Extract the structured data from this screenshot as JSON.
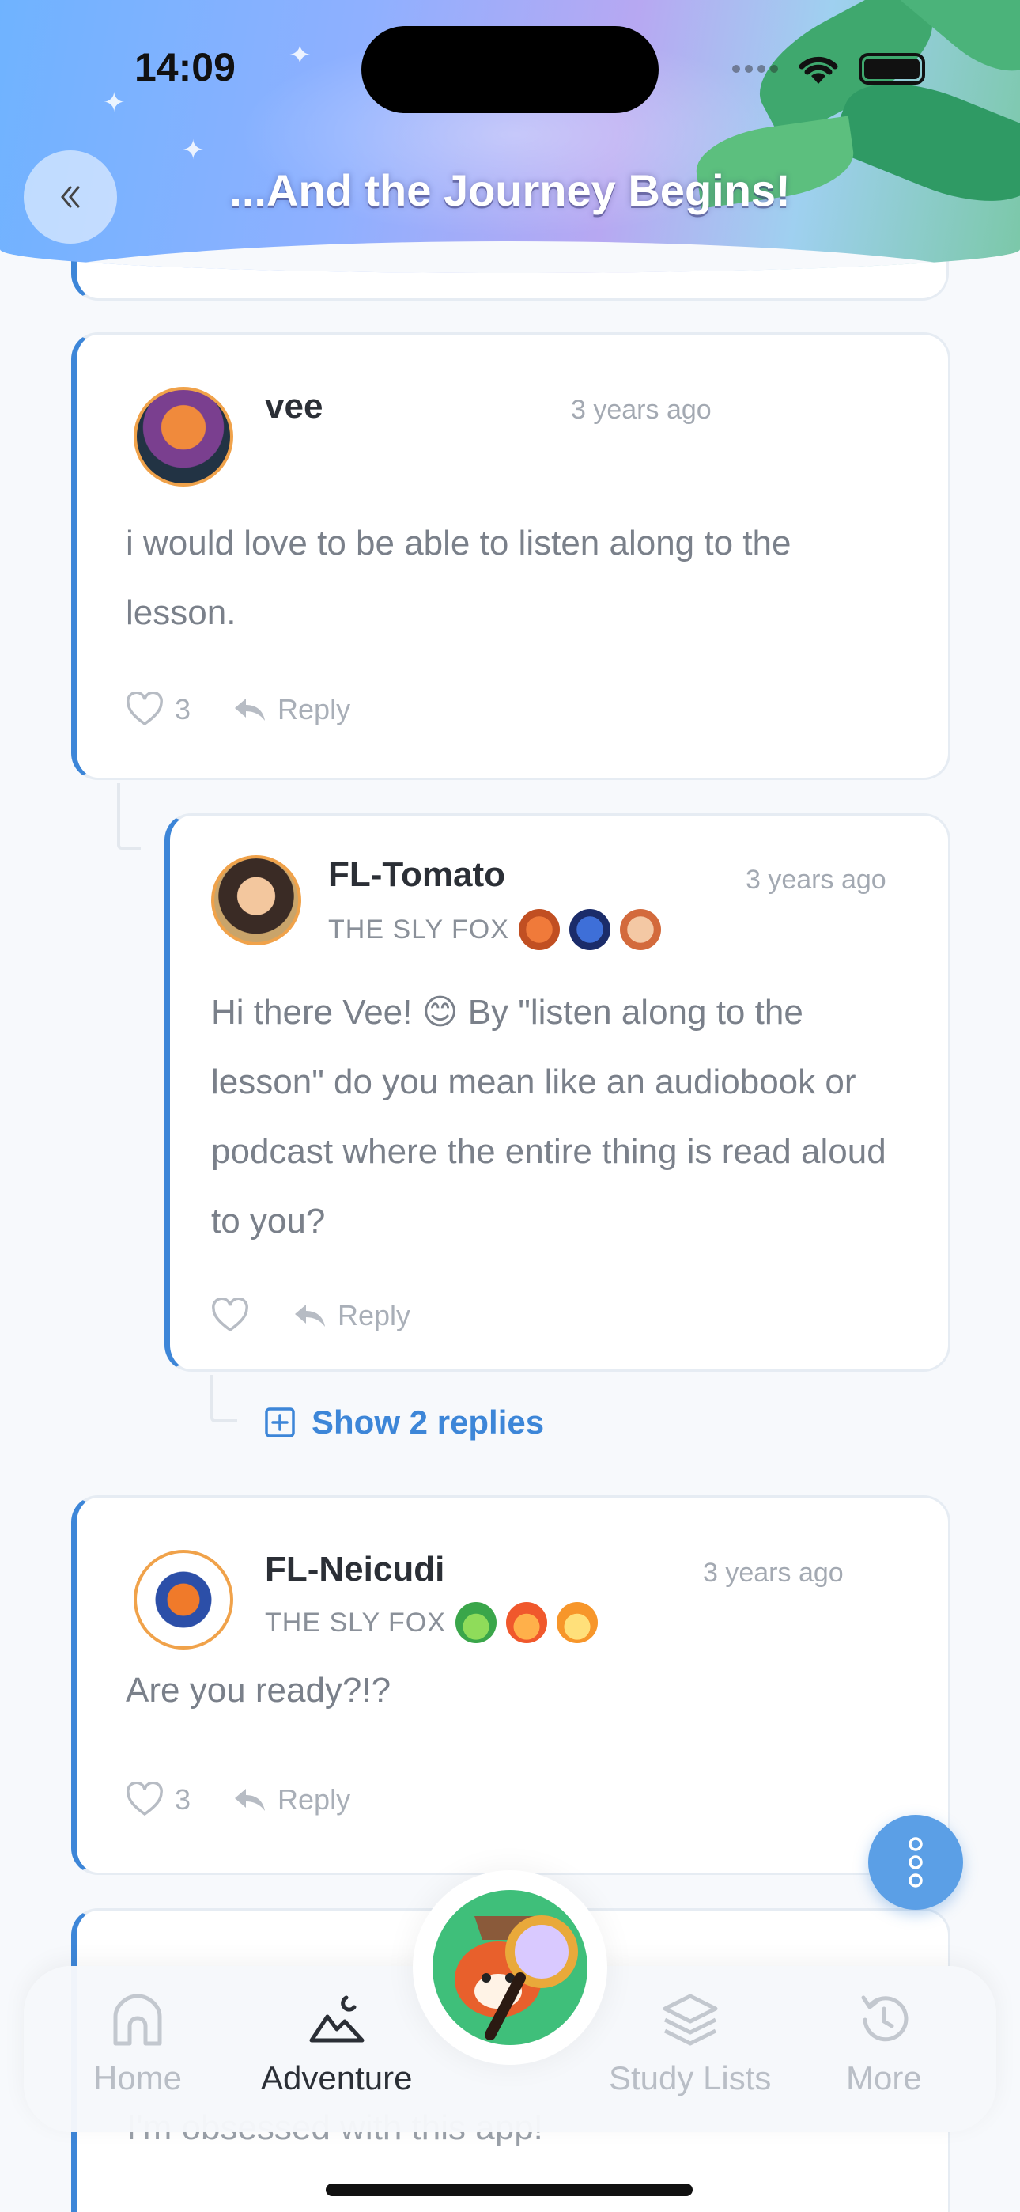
{
  "status_bar": {
    "time": "14:09"
  },
  "header": {
    "title": "...And the Journey Begins!"
  },
  "comments": [
    {
      "username": "vee",
      "timestamp": "3 years ago",
      "text": "i would love to be able to listen along to the lesson.",
      "likes": "3",
      "reply_label": "Reply"
    },
    {
      "username": "FL-Tomato",
      "timestamp": "3 years ago",
      "rank": "THE SLY FOX",
      "text": "Hi there Vee! 😊  By \"listen along to the lesson\" do you mean like an audiobook or podcast where the entire thing is read aloud to you?",
      "likes": "",
      "reply_label": "Reply"
    },
    {
      "username": "FL-Neicudi",
      "timestamp": "3 years ago",
      "rank": "THE SLY FOX",
      "text": "Are you ready?!?",
      "likes": "3",
      "reply_label": "Reply"
    }
  ],
  "show_replies": "Show 2 replies",
  "peek_comment_text": "I'm obsessed with this app!",
  "tabbar": {
    "tabs": [
      {
        "label": "Home",
        "icon": "home-icon",
        "active": false
      },
      {
        "label": "Adventure",
        "icon": "mountain-icon",
        "active": true
      },
      {
        "label": "Study Lists",
        "icon": "layers-icon",
        "active": false
      },
      {
        "label": "More",
        "icon": "history-icon",
        "active": false
      }
    ]
  },
  "colors": {
    "accent": "#3d86d8",
    "fab": "#5b9fe6"
  }
}
